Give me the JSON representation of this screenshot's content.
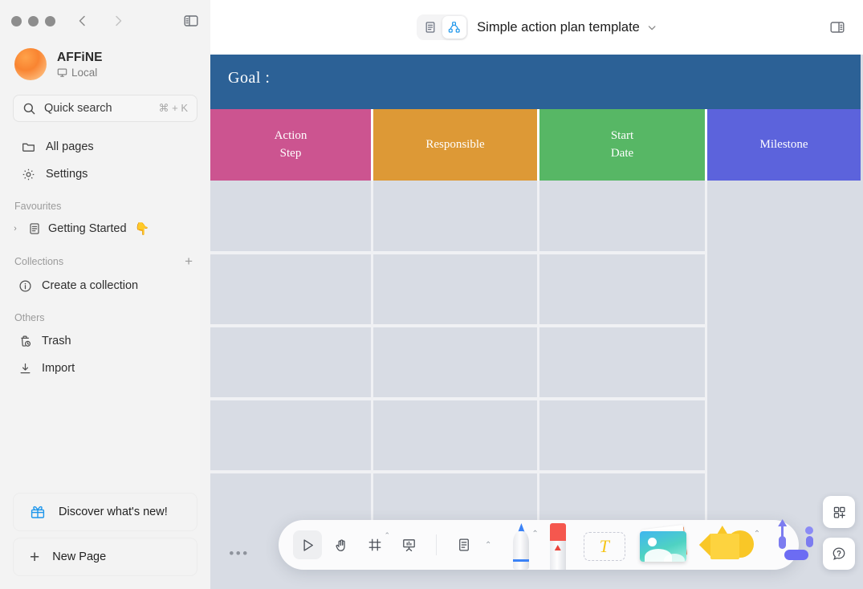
{
  "window": {
    "traffic_lights": [
      "close",
      "minimize",
      "maximize"
    ],
    "back_label": "‹",
    "forward_label": "›",
    "sidebar_toggle_icon": "sidebar-toggle-icon"
  },
  "sidebar": {
    "workspace": {
      "name": "AFFiNE",
      "sync_status": "Local",
      "sync_icon": "desktop-icon",
      "avatar_name": "workspace-avatar"
    },
    "search": {
      "placeholder": "Quick search",
      "shortcut": "⌘ + K",
      "icon": "search-icon"
    },
    "nav": [
      {
        "label": "All pages",
        "icon": "folder-icon"
      },
      {
        "label": "Settings",
        "icon": "gear-icon"
      }
    ],
    "sections": [
      {
        "title": "Favourites",
        "has_add": false,
        "items": [
          {
            "label": "Getting Started",
            "icon": "page-icon",
            "emoji": "👇",
            "expand_caret": "›"
          }
        ]
      },
      {
        "title": "Collections",
        "has_add": true,
        "add_label": "+",
        "items": [
          {
            "label": "Create a collection",
            "icon": "info-icon",
            "emoji": "",
            "expand_caret": ""
          }
        ]
      },
      {
        "title": "Others",
        "has_add": false,
        "items": [
          {
            "label": "Trash",
            "icon": "trash-icon",
            "emoji": "",
            "expand_caret": ""
          },
          {
            "label": "Import",
            "icon": "import-icon",
            "emoji": "",
            "expand_caret": ""
          }
        ]
      }
    ],
    "bottom_buttons": [
      {
        "label": "Discover what's new!",
        "icon": "gift-icon"
      },
      {
        "label": "New Page",
        "icon": "plus-icon"
      }
    ]
  },
  "header": {
    "mode_page_icon": "page-mode-icon",
    "mode_edgeless_icon": "edgeless-mode-icon",
    "active_mode": "edgeless",
    "doc_title": "Simple action plan template",
    "title_caret": "⌄",
    "right_panel_icon": "right-sidebar-toggle-icon"
  },
  "board": {
    "goal_label": "Goal  :",
    "goal_band_color": "#2c6196",
    "columns": [
      {
        "label": "Action\nStep",
        "line1": "Action",
        "line2": "Step",
        "color": "#cc5490"
      },
      {
        "label": "Responsible",
        "line1": "Responsible",
        "line2": "",
        "color": "#dd9936"
      },
      {
        "label": "Start\nDate",
        "line1": "Start",
        "line2": "Date",
        "color": "#57b765"
      },
      {
        "label": "Milestone",
        "line1": "Milestone",
        "line2": "",
        "color": "#5c63dc"
      }
    ],
    "body_cell_color": "#d8dce4",
    "grid_line_color": "#f0f1f4",
    "row_count": 5
  },
  "toolbar": {
    "tools": [
      {
        "name": "select-tool",
        "icon": "cursor-arrow-icon",
        "selected": true,
        "caret": ""
      },
      {
        "name": "hand-tool",
        "icon": "hand-icon",
        "selected": false,
        "caret": ""
      },
      {
        "name": "frame-tool",
        "icon": "frame-icon",
        "selected": false,
        "caret": "⌃"
      },
      {
        "name": "present-tool",
        "icon": "presentation-icon",
        "selected": false,
        "caret": ""
      },
      {
        "name": "note-tool",
        "icon": "note-icon",
        "selected": false,
        "caret": "⌃"
      }
    ],
    "creative_tools": [
      {
        "name": "pen-tool",
        "icon": "pen-icon",
        "caret": "⌃"
      },
      {
        "name": "eraser-tool",
        "icon": "eraser-icon",
        "caret": ""
      },
      {
        "name": "text-tool",
        "icon": "text-T-icon",
        "caret": ""
      },
      {
        "name": "image-tool",
        "icon": "image-icon",
        "caret": ""
      },
      {
        "name": "shape-tool",
        "icon": "shapes-icon",
        "caret": "⌃"
      },
      {
        "name": "connector-tool",
        "icon": "connector-icon",
        "caret": ""
      }
    ]
  },
  "fabs": [
    {
      "name": "add-widget-button",
      "icon": "grid-plus-icon"
    },
    {
      "name": "help-button",
      "icon": "question-bubble-icon"
    }
  ],
  "canvas_menu": {
    "dots_label": "•••"
  }
}
